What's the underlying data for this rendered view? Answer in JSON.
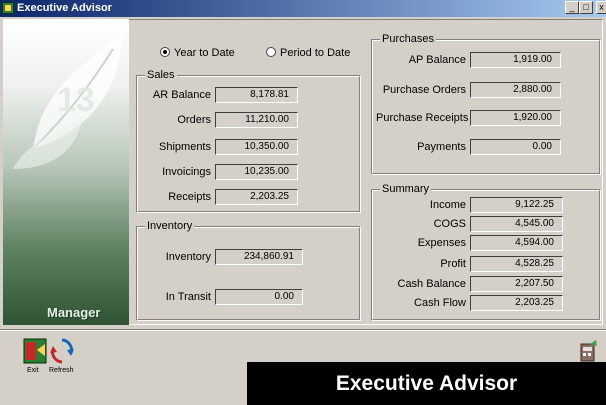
{
  "window": {
    "title": "Executive Advisor",
    "min_label": "_",
    "max_label": "□",
    "close_label": "x"
  },
  "side_panel": {
    "label": "Manager",
    "logo_text": "13"
  },
  "period": {
    "year_to_date": "Year to Date",
    "period_to_date": "Period to Date",
    "selected": "Year to Date"
  },
  "sales": {
    "title": "Sales",
    "ar_balance_label": "AR Balance",
    "ar_balance": "8,178.81",
    "orders_label": "Orders",
    "orders": "11,210.00",
    "shipments_label": "Shipments",
    "shipments": "10,350.00",
    "invoicings_label": "Invoicings",
    "invoicings": "10,235.00",
    "receipts_label": "Receipts",
    "receipts": "2,203.25"
  },
  "inventory": {
    "title": "Inventory",
    "inventory_label": "Inventory",
    "inventory": "234,860.91",
    "in_transit_label": "In Transit",
    "in_transit": "0.00"
  },
  "purchases": {
    "title": "Purchases",
    "ap_balance_label": "AP Balance",
    "ap_balance": "1,919.00",
    "purchase_orders_label": "Purchase Orders",
    "purchase_orders": "2,880.00",
    "purchase_receipts_label": "Purchase Receipts",
    "purchase_receipts": "1,920.00",
    "payments_label": "Payments",
    "payments": "0.00"
  },
  "summary": {
    "title": "Summary",
    "income_label": "Income",
    "income": "9,122.25",
    "cogs_label": "COGS",
    "cogs": "4,545.00",
    "expenses_label": "Expenses",
    "expenses": "4,594.00",
    "profit_label": "Profit",
    "profit": "4,528.25",
    "cash_balance_label": "Cash Balance",
    "cash_balance": "2,207.50",
    "cash_flow_label": "Cash Flow",
    "cash_flow": "2,203.25"
  },
  "toolbar": {
    "exit_label": "Exit",
    "refresh_label": "Refresh"
  },
  "banner": {
    "text": "Executive Advisor"
  },
  "colors": {
    "title_start": "#0a246a",
    "title_end": "#a6caf0",
    "face": "#d4d0c8",
    "panel_dark": "#2f5333"
  }
}
